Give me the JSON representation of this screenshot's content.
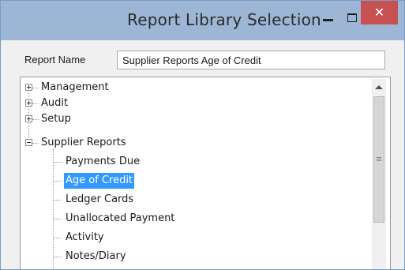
{
  "window": {
    "title": "Report Library Selection",
    "controls": {
      "minimize": "–",
      "maximize": "☐",
      "close": "✕"
    }
  },
  "report_name": {
    "label": "Report Name",
    "value": "Supplier Reports Age of Credit"
  },
  "tree": {
    "nodes": [
      {
        "label": "Management",
        "expanded": false
      },
      {
        "label": "Audit",
        "expanded": false
      },
      {
        "label": "Setup",
        "expanded": false
      },
      {
        "label": "Supplier Reports",
        "expanded": true,
        "children": [
          {
            "label": "Payments Due"
          },
          {
            "label": "Age of Credit",
            "selected": true
          },
          {
            "label": "Ledger Cards"
          },
          {
            "label": "Unallocated Payment"
          },
          {
            "label": "Activity"
          },
          {
            "label": "Notes/Diary"
          }
        ]
      }
    ]
  },
  "colors": {
    "titlebar": "#9db6d5",
    "close_button": "#c75050",
    "selection": "#3399ff"
  }
}
